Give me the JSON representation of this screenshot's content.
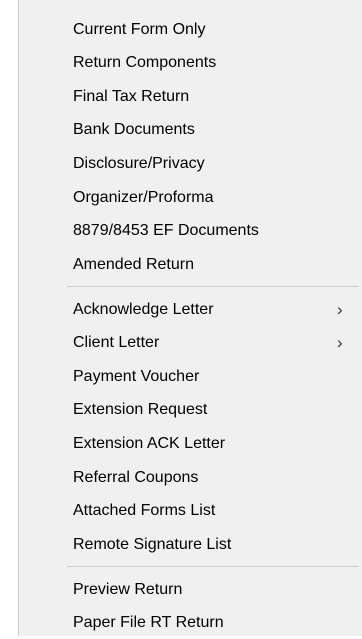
{
  "menu": {
    "group1": [
      {
        "label": "Current Form Only"
      },
      {
        "label": "Return Components"
      },
      {
        "label": "Final Tax Return"
      },
      {
        "label": "Bank Documents"
      },
      {
        "label": "Disclosure/Privacy"
      },
      {
        "label": "Organizer/Proforma"
      },
      {
        "label": "8879/8453 EF Documents"
      },
      {
        "label": "Amended Return"
      }
    ],
    "group2": [
      {
        "label": "Acknowledge Letter",
        "submenu_glyph": "›"
      },
      {
        "label": "Client Letter",
        "submenu_glyph": "›"
      },
      {
        "label": "Payment Voucher"
      },
      {
        "label": "Extension Request"
      },
      {
        "label": "Extension ACK Letter"
      },
      {
        "label": "Referral Coupons"
      },
      {
        "label": "Attached Forms List"
      },
      {
        "label": "Remote Signature List"
      }
    ],
    "group3": [
      {
        "label": "Preview Return"
      },
      {
        "label": "Paper File RT Return"
      }
    ],
    "icons": {
      "submenu": "chevron-right-icon"
    },
    "colors": {
      "background": "#f0f0f0",
      "separator": "#cfcfcf",
      "text": "#000000"
    }
  }
}
